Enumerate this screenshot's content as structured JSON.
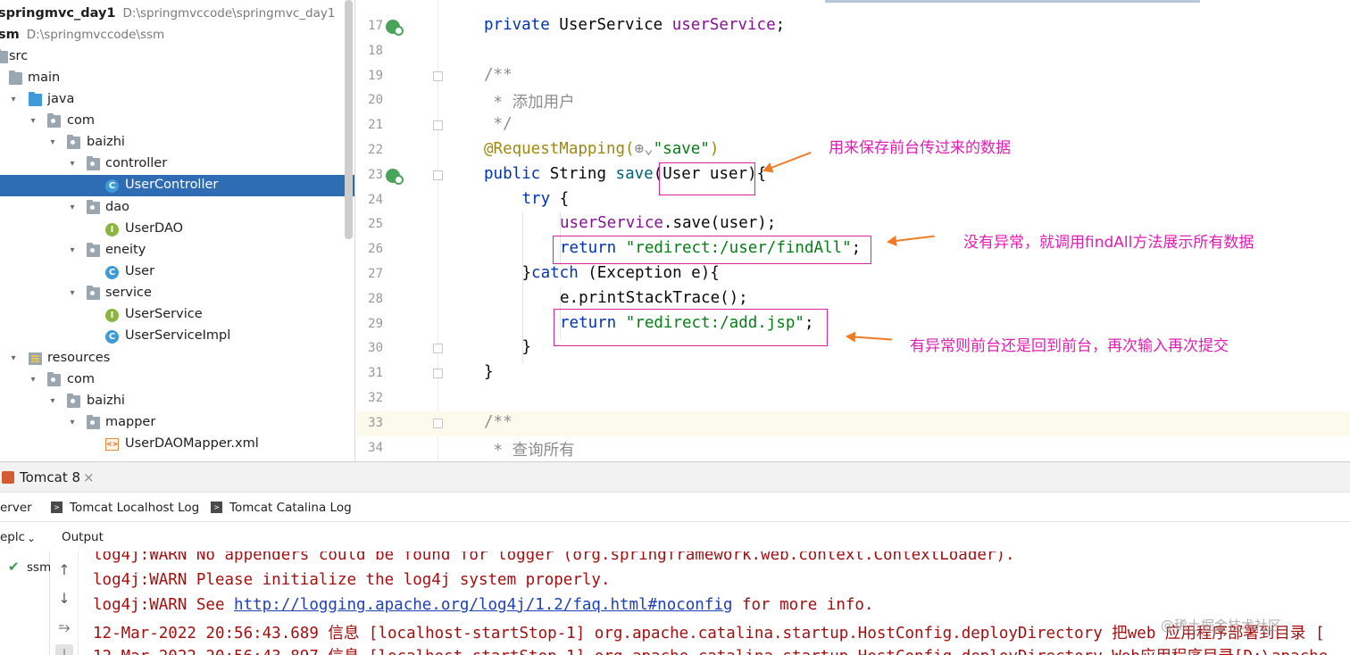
{
  "project_tree": {
    "items": [
      {
        "label": "springmvc_day1",
        "path": "D:\\springmvccode\\springmvc_day1",
        "icon": "module-icon"
      },
      {
        "label": "sm",
        "path": "D:\\springmvccode\\ssm",
        "icon": "module-icon"
      },
      {
        "label": "src",
        "icon": "folder-icon"
      },
      {
        "label": "main",
        "icon": "folder-icon"
      },
      {
        "label": "java",
        "icon": "source-folder-icon"
      },
      {
        "label": "com",
        "icon": "package-icon"
      },
      {
        "label": "baizhi",
        "icon": "package-icon"
      },
      {
        "label": "controller",
        "icon": "package-icon"
      },
      {
        "label": "UserController",
        "icon": "class-icon",
        "selected": true
      },
      {
        "label": "dao",
        "icon": "package-icon"
      },
      {
        "label": "UserDAO",
        "icon": "interface-icon"
      },
      {
        "label": "eneity",
        "icon": "package-icon"
      },
      {
        "label": "User",
        "icon": "class-icon"
      },
      {
        "label": "service",
        "icon": "package-icon"
      },
      {
        "label": "UserService",
        "icon": "interface-icon"
      },
      {
        "label": "UserServiceImpl",
        "icon": "class-icon"
      },
      {
        "label": "resources",
        "icon": "resources-folder-icon"
      },
      {
        "label": "com",
        "icon": "package-icon"
      },
      {
        "label": "baizhi",
        "icon": "package-icon"
      },
      {
        "label": "mapper",
        "icon": "package-icon"
      },
      {
        "label": "UserDAOMapper.xml",
        "icon": "xml-file-icon"
      }
    ],
    "class_letter": "C",
    "interface_letter": "I",
    "xml_letter": "<>"
  },
  "editor": {
    "line_numbers": [
      "17",
      "18",
      "19",
      "20",
      "21",
      "22",
      "23",
      "24",
      "25",
      "26",
      "27",
      "28",
      "29",
      "30",
      "31",
      "32",
      "33",
      "34"
    ],
    "l17": {
      "kw": "private ",
      "type": "UserService ",
      "field": "userService",
      "end": ";"
    },
    "l19": "/**",
    "l20": " * 添加用户",
    "l21": " */",
    "l22": {
      "ann": "@RequestMapping(",
      "glyph": "⊕⌄",
      "str": "\"save\"",
      "end": ")"
    },
    "l23": {
      "kw": "public ",
      "type": "String ",
      "fn": "save",
      "open": "(",
      "param": "User user",
      "close": "){"
    },
    "l24": {
      "kw": "try ",
      "end": "{"
    },
    "l25": {
      "field": "userService",
      "rest": ".save(user);"
    },
    "l26": {
      "kw": "return ",
      "str": "\"redirect:/user/findAll\"",
      "end": ";"
    },
    "l27": {
      "pre": "}",
      "kw": "catch ",
      "rest": "(Exception e){"
    },
    "l28": "e.printStackTrace();",
    "l29": {
      "kw": "return ",
      "str": "\"redirect:/add.jsp\"",
      "end": ";"
    },
    "l30": "}",
    "l31": "}",
    "l33": "/**",
    "l34": " * 查询所有"
  },
  "annotations": {
    "note1": "用来保存前台传过来的数据",
    "note2": "没有异常，就调用findAll方法展示所有数据",
    "note3": "有异常则前台还是回到前台，再次输入再次提交"
  },
  "bottom_panel": {
    "run_title": "Tomcat 8",
    "close_glyph": "×",
    "tabs": [
      "erver",
      "Tomcat Localhost Log",
      "Tomcat Catalina Log"
    ],
    "deploy_label": "eplc",
    "output_label": "Output",
    "deploy_item": "ssm",
    "console": {
      "line1": "log4j:WARN No appenders could be found for logger (org.springframework.web.context.ContextLoader).",
      "line2": "log4j:WARN Please initialize the log4j system properly.",
      "line3_pre": "log4j:WARN See ",
      "line3_link": "http://logging.apache.org/log4j/1.2/faq.html#noconfig",
      "line3_post": " for more info.",
      "line4": "12-Mar-2022 20:56:43.689 信息 [localhost-startStop-1] org.apache.catalina.startup.HostConfig.deployDirectory 把web 应用程序部署到目录 [",
      "line5": "12-Mar-2022 20:56:43.897 信息 [localhost-startStop-1] org.apache.catalina.startup.HostConfig.deployDirectory Web应用程序目录[D:\\apache"
    }
  },
  "watermark": "@稀土掘金技术社区",
  "colors": {
    "selection": "#2e6db4",
    "annotation_magenta": "#e21eb3",
    "arrow_orange": "#f07b22",
    "console_red": "#a40f0f",
    "keyword": "#0033b3",
    "string": "#067d17"
  }
}
